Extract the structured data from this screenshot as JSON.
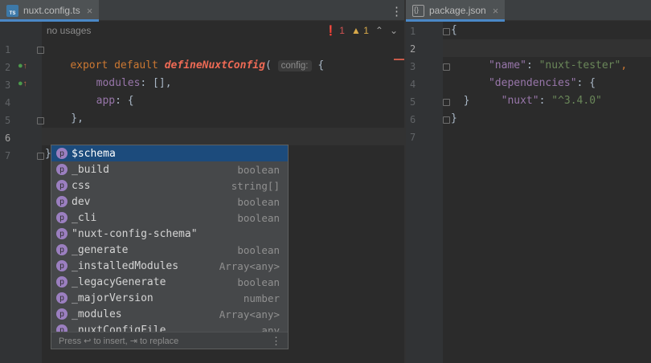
{
  "tabs": {
    "left": {
      "label": "nuxt.config.ts",
      "icon": "typescript-file-icon",
      "icon_text": "TS",
      "close": "×"
    },
    "right": {
      "label": "package.json",
      "icon": "json-file-icon",
      "close": "×"
    },
    "menu": "⋮"
  },
  "left_editor": {
    "usages": "no usages",
    "inspections": {
      "errors": "1",
      "warnings": "1",
      "error_glyph": "❗",
      "warning_glyph": "▲",
      "up": "⌃",
      "down": "⌄"
    },
    "line_numbers": [
      "1",
      "2",
      "3",
      "4",
      "5",
      "6",
      "7"
    ],
    "lines": {
      "l1_kw": "export default ",
      "l1_fn": "defineNuxtConfig",
      "l1_paren": "(",
      "l1_hint": "config:",
      "l1_brace": " {",
      "l2_prop": "    modules",
      "l2_rest": ": [],",
      "l3_prop": "    app",
      "l3_rest": ": {",
      "l5": "    },",
      "l7": "}"
    }
  },
  "right_editor": {
    "line_numbers": [
      "1",
      "2",
      "3",
      "4",
      "5",
      "6",
      "7"
    ],
    "lines": {
      "l1": "{",
      "l2_key": "  \"name\"",
      "l2_colon": ": ",
      "l2_val": "\"nuxt-tester\"",
      "l2_comma": ",",
      "l3_key": "  \"dependencies\"",
      "l3_rest": ": {",
      "l4_key": "    \"nuxt\"",
      "l4_colon": ": ",
      "l4_val": "\"^3.4.0\"",
      "l5": "  }",
      "l6": "}"
    }
  },
  "completion": {
    "items": [
      {
        "icon": "p",
        "name": "$schema",
        "type": ""
      },
      {
        "icon": "p",
        "name": "_build",
        "type": "boolean"
      },
      {
        "icon": "p",
        "name": "css",
        "type": "string[]"
      },
      {
        "icon": "p",
        "name": "dev",
        "type": "boolean"
      },
      {
        "icon": "p",
        "name": "_cli",
        "type": "boolean"
      },
      {
        "icon": "p",
        "name": "\"nuxt-config-schema\"",
        "type": ""
      },
      {
        "icon": "p",
        "name": "_generate",
        "type": "boolean"
      },
      {
        "icon": "p",
        "name": "_installedModules",
        "type": "Array<any>"
      },
      {
        "icon": "p",
        "name": "_legacyGenerate",
        "type": "boolean"
      },
      {
        "icon": "p",
        "name": "_majorVersion",
        "type": "number"
      },
      {
        "icon": "p",
        "name": "_modules",
        "type": "Array<any>"
      },
      {
        "icon": "p",
        "name": "_nuxtConfigFile",
        "type": "any"
      }
    ],
    "footer": "Press ↩ to insert, ⇥ to replace",
    "footer_menu": "⋮"
  }
}
